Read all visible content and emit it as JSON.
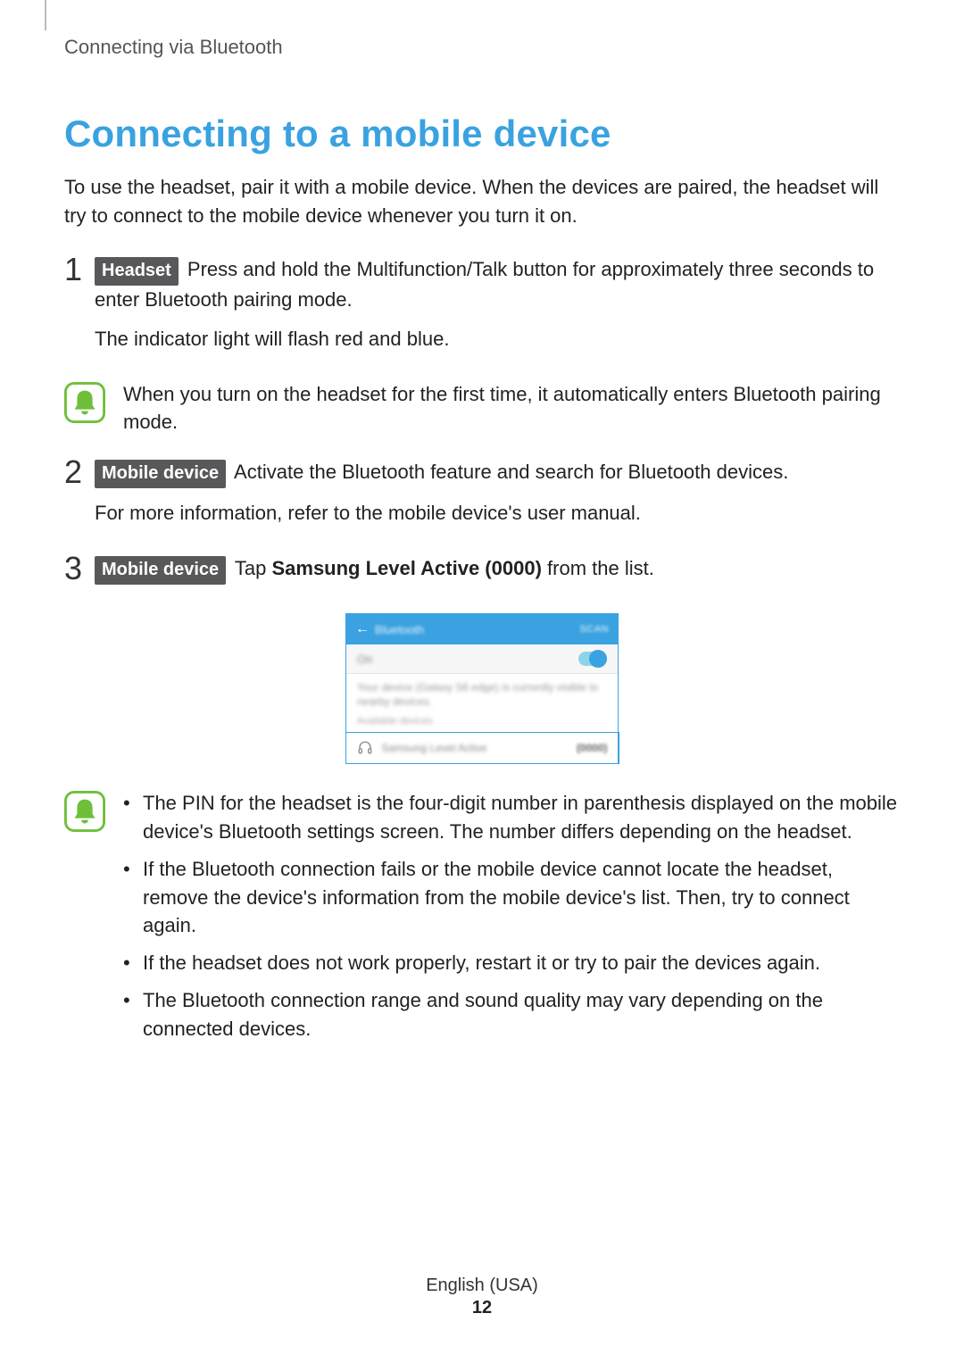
{
  "breadcrumb": "Connecting via Bluetooth",
  "title": "Connecting to a mobile device",
  "intro": "To use the headset, pair it with a mobile device. When the devices are paired, the headset will try to connect to the mobile device whenever you turn it on.",
  "steps": {
    "s1": {
      "num": "1",
      "tag": "Headset",
      "text_after_tag": " Press and hold the Multifunction/Talk button for approximately three seconds to enter Bluetooth pairing mode.",
      "line2": "The indicator light will flash red and blue."
    },
    "s2": {
      "num": "2",
      "tag": "Mobile device",
      "text_after_tag": " Activate the Bluetooth feature and search for Bluetooth devices.",
      "line2": "For more information, refer to the mobile device's user manual."
    },
    "s3": {
      "num": "3",
      "tag": "Mobile device",
      "text_after_tag_pre": " Tap ",
      "bold": "Samsung Level Active (0000)",
      "text_after_tag_post": " from the list."
    }
  },
  "note1": "When you turn on the headset for the first time, it automatically enters Bluetooth pairing mode.",
  "note2": {
    "b1": "The PIN for the headset is the four-digit number in parenthesis displayed on the mobile device's Bluetooth settings screen. The number differs depending on the headset.",
    "b2": "If the Bluetooth connection fails or the mobile device cannot locate the headset, remove the device's information from the mobile device's list. Then, try to connect again.",
    "b3": "If the headset does not work properly, restart it or try to pair the devices again.",
    "b4": "The Bluetooth connection range and sound quality may vary depending on the connected devices."
  },
  "phone": {
    "title": "Bluetooth",
    "scan": "SCAN",
    "on": "On",
    "desc": "Your device (Galaxy S6 edge) is currently visible to nearby devices.",
    "avail": "Available devices",
    "device_name": "Samsung Level Active",
    "device_pin": "(0000)"
  },
  "footer": {
    "lang": "English (USA)",
    "page": "12"
  }
}
